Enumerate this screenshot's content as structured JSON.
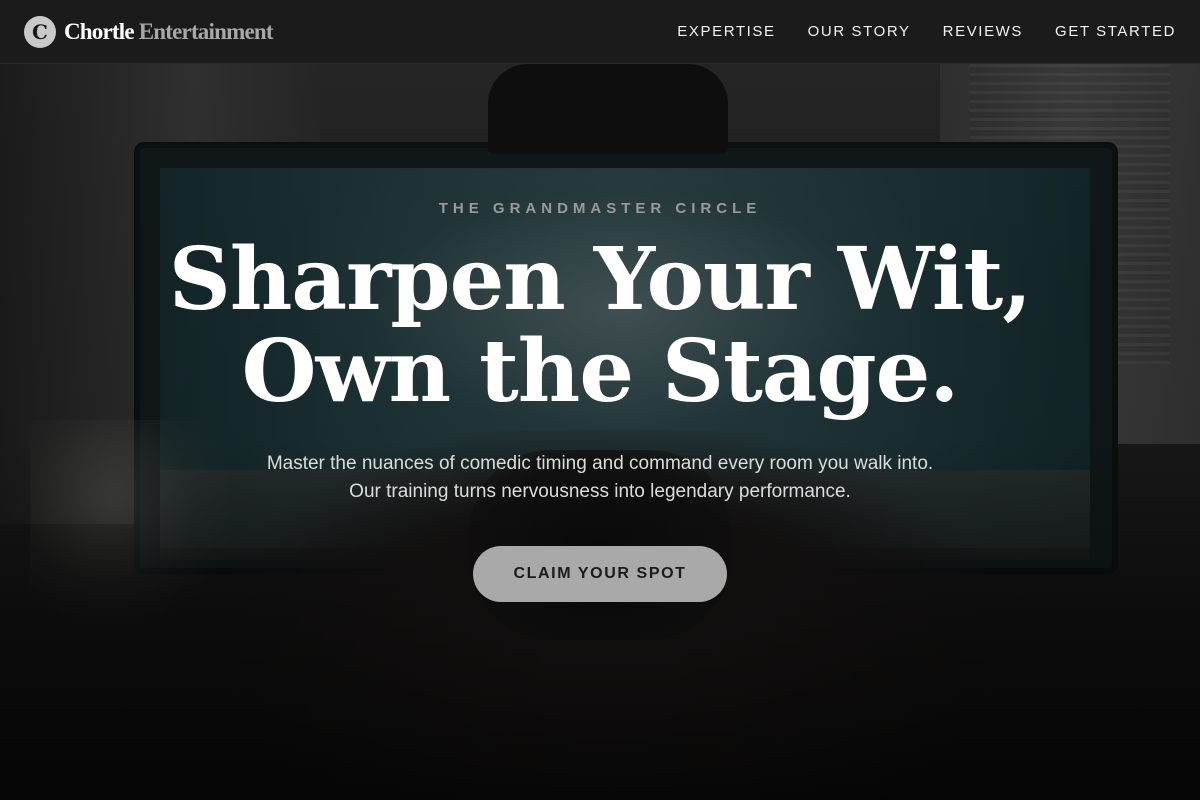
{
  "nav": {
    "logo_letter": "C",
    "brand_primary": "Chortle",
    "brand_secondary": "Entertainment",
    "links": [
      {
        "label": "EXPERTISE"
      },
      {
        "label": "OUR STORY"
      },
      {
        "label": "REVIEWS"
      },
      {
        "label": "GET STARTED"
      }
    ]
  },
  "hero": {
    "eyebrow": "THE GRANDMASTER CIRCLE",
    "headline_line1": "Sharpen Your Wit,",
    "headline_line2": "Own the Stage.",
    "subtitle": "Master the nuances of comedic timing and command every room you walk into. Our training turns nervousness into legendary performance.",
    "cta_label": "CLAIM YOUR SPOT"
  },
  "colors": {
    "nav_bg": "#1b1b1b",
    "cta_bg": "#a9a9a9",
    "eyebrow": "#9a9a9a",
    "brand_secondary": "#a8a8a8"
  }
}
